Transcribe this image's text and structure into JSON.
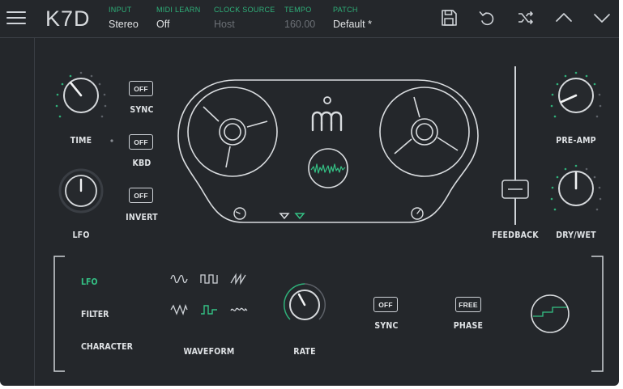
{
  "header": {
    "logo": "K7D",
    "fields": [
      {
        "label": "INPUT",
        "value": "Stereo"
      },
      {
        "label": "MIDI LEARN",
        "value": "Off"
      },
      {
        "label": "CLOCK SOURCE",
        "value": "Host"
      },
      {
        "label": "TEMPO",
        "value": "160.00"
      },
      {
        "label": "PATCH",
        "value": "Default *"
      }
    ],
    "icons": [
      "save-icon",
      "undo-icon",
      "shuffle-icon",
      "chevron-up-icon",
      "chevron-down-icon"
    ]
  },
  "left": {
    "time_label": "TIME",
    "lfo_label": "LFO",
    "sync": {
      "button": "OFF",
      "label": "SYNC"
    },
    "kbd": {
      "button": "OFF",
      "label": "KBD"
    },
    "invert": {
      "button": "OFF",
      "label": "INVERT"
    }
  },
  "right": {
    "feedback_label": "FEEDBACK",
    "preamp_label": "PRE-AMP",
    "drywet_label": "DRY/WET"
  },
  "bottom": {
    "tabs": [
      "LFO",
      "FILTER",
      "CHARACTER"
    ],
    "active_tab": "LFO",
    "waveform_label": "WAVEFORM",
    "rate_label": "RATE",
    "sync": {
      "button": "OFF",
      "label": "SYNC"
    },
    "phase": {
      "button": "FREE",
      "label": "PHASE"
    }
  },
  "colors": {
    "background": "#24272b",
    "accent": "#34c285",
    "foreground": "#dfe2e5",
    "accent_label": "#2fb17a"
  }
}
